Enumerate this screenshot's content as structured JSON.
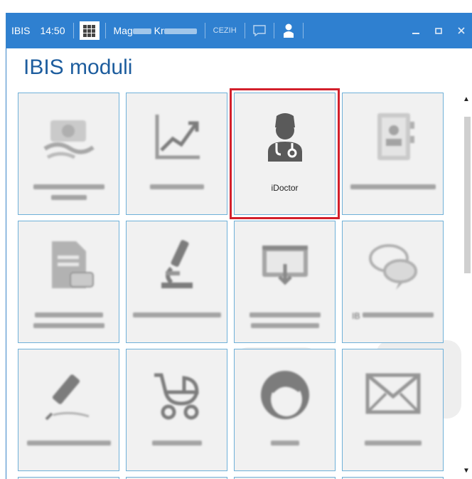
{
  "titlebar": {
    "app_name": "IBIS",
    "time": "14:50",
    "user_visible": "Mag",
    "user_initial": "Kr",
    "cezih": "CEZIH",
    "icons": [
      "apps-grid-icon",
      "chat-icon",
      "user-icon",
      "minimize-icon",
      "maximize-icon",
      "close-icon"
    ],
    "accent": "#2f80d0"
  },
  "page": {
    "title": "IBIS moduli",
    "title_color": "#1d5d9e"
  },
  "tiles": [
    {
      "label": "",
      "icon": "money-icon"
    },
    {
      "label": "",
      "icon": "chart-icon"
    },
    {
      "label": "iDoctor",
      "icon": "doctor-icon",
      "selected": true,
      "highlight_color": "#d31f2b"
    },
    {
      "label": "",
      "icon": "address-book-icon"
    },
    {
      "label": "",
      "icon": "document-icon"
    },
    {
      "label": "",
      "icon": "microscope-icon"
    },
    {
      "label": "",
      "icon": "screen-icon"
    },
    {
      "label": "IB",
      "icon": "chat-bubbles-icon"
    },
    {
      "label": "",
      "icon": "syringe-icon"
    },
    {
      "label": "",
      "icon": "stroller-icon"
    },
    {
      "label": "",
      "icon": "person-icon"
    },
    {
      "label": "",
      "icon": "envelope-icon"
    }
  ]
}
